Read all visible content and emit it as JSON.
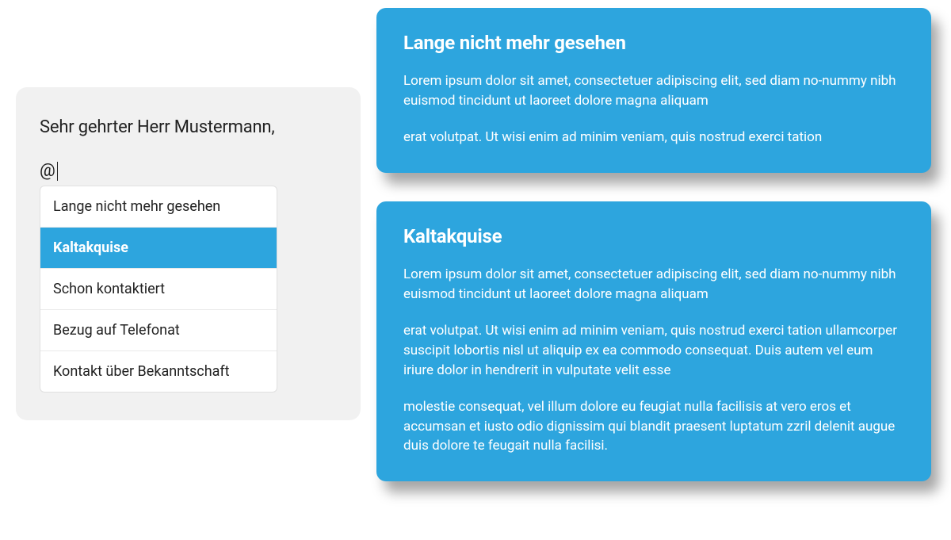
{
  "editor": {
    "salutation": "Sehr gehrter Herr Mustermann,",
    "mention_trigger": "@"
  },
  "dropdown": {
    "items": [
      {
        "label": "Lange nicht mehr gesehen",
        "selected": false
      },
      {
        "label": "Kaltakquise",
        "selected": true
      },
      {
        "label": "Schon kontaktiert",
        "selected": false
      },
      {
        "label": "Bezug auf Telefonat",
        "selected": false
      },
      {
        "label": "Kontakt über Bekanntschaft",
        "selected": false
      }
    ]
  },
  "cards": [
    {
      "title": "Lange nicht mehr gesehen",
      "paragraphs": [
        "Lorem ipsum dolor sit amet, consectetuer adipiscing elit, sed diam no-nummy nibh euismod tincidunt ut laoreet dolore magna aliquam",
        "erat volutpat. Ut wisi enim ad minim veniam, quis nostrud exerci tation"
      ]
    },
    {
      "title": "Kaltakquise",
      "paragraphs": [
        "Lorem ipsum dolor sit amet, consectetuer adipiscing elit, sed diam no-nummy nibh euismod tincidunt ut laoreet dolore magna aliquam",
        "erat volutpat. Ut wisi enim ad minim veniam, quis nostrud exerci tation ullamcorper suscipit lobortis nisl ut aliquip ex ea commodo consequat. Duis autem vel eum iriure dolor in hendrerit in vulputate velit esse",
        "molestie consequat, vel illum dolore eu feugiat nulla facilisis at vero eros et accumsan et iusto odio dignissim qui blandit praesent luptatum zzril delenit augue duis dolore te feugait nulla facilisi."
      ]
    }
  ]
}
